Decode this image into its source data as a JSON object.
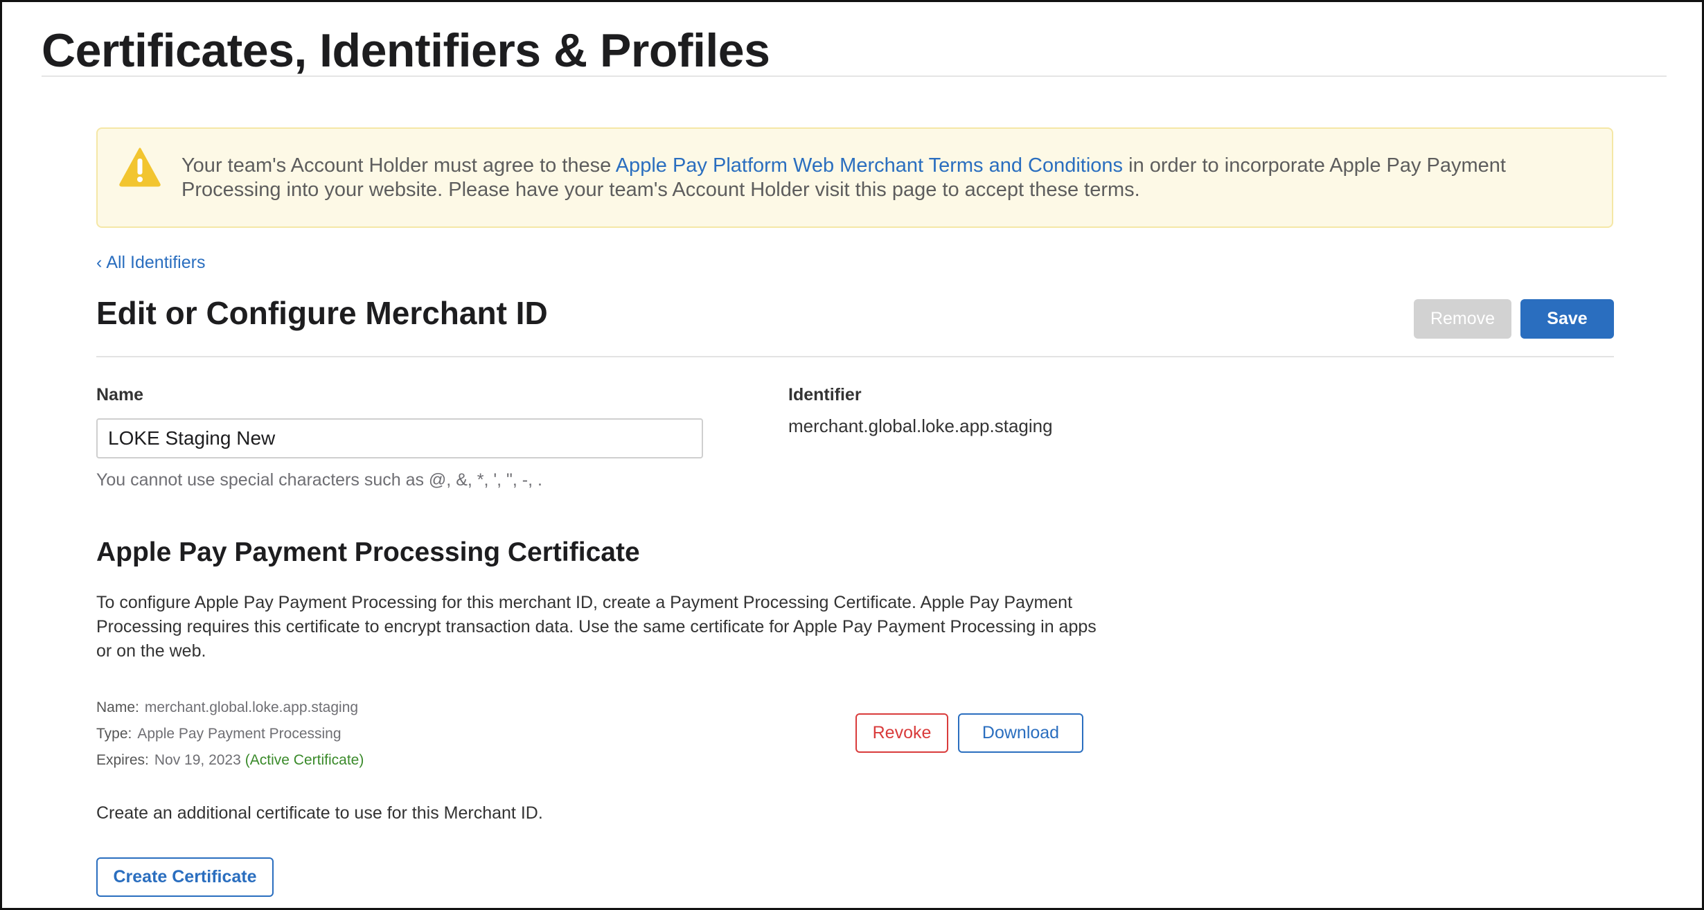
{
  "page": {
    "title": "Certificates, Identifiers & Profiles"
  },
  "alert": {
    "icon": "warning-icon",
    "text_before": "Your team's Account Holder must agree to these ",
    "link_text": "Apple Pay Platform Web Merchant Terms and Conditions",
    "text_after": " in order to incorporate Apple Pay Payment Processing into your website. Please have your team's Account Holder visit this page to accept these terms.",
    "background": "#fdf9e6",
    "icon_color": "#f2c530"
  },
  "nav": {
    "back_chevron": "‹",
    "back_label": "All Identifiers"
  },
  "header": {
    "heading": "Edit or Configure Merchant ID",
    "remove_label": "Remove",
    "save_label": "Save"
  },
  "form": {
    "name_label": "Name",
    "name_value": "LOKE Staging New",
    "name_hint": "You cannot use special characters such as @, &, *, ', \", -, .",
    "identifier_label": "Identifier",
    "identifier_value": "merchant.global.loke.app.staging"
  },
  "certificate": {
    "heading": "Apple Pay Payment Processing Certificate",
    "description": "To configure Apple Pay Payment Processing for this merchant ID, create a Payment Processing Certificate. Apple Pay Payment Processing requires this certificate to encrypt transaction data. Use the same certificate for Apple Pay Payment Processing in apps or on the web.",
    "name_key": "Name:",
    "name_value": "merchant.global.loke.app.staging",
    "type_key": "Type:",
    "type_value": "Apple Pay Payment Processing",
    "expires_key": "Expires:",
    "expires_value": "Nov 19, 2023",
    "status": "(Active Certificate)",
    "revoke_label": "Revoke",
    "download_label": "Download",
    "additional_text": "Create an additional certificate to use for this Merchant ID.",
    "create_label": "Create Certificate"
  },
  "colors": {
    "accent": "#2a6ebf",
    "danger": "#d93b3b",
    "success": "#3a8a2a",
    "disabled": "#d2d2d2"
  }
}
